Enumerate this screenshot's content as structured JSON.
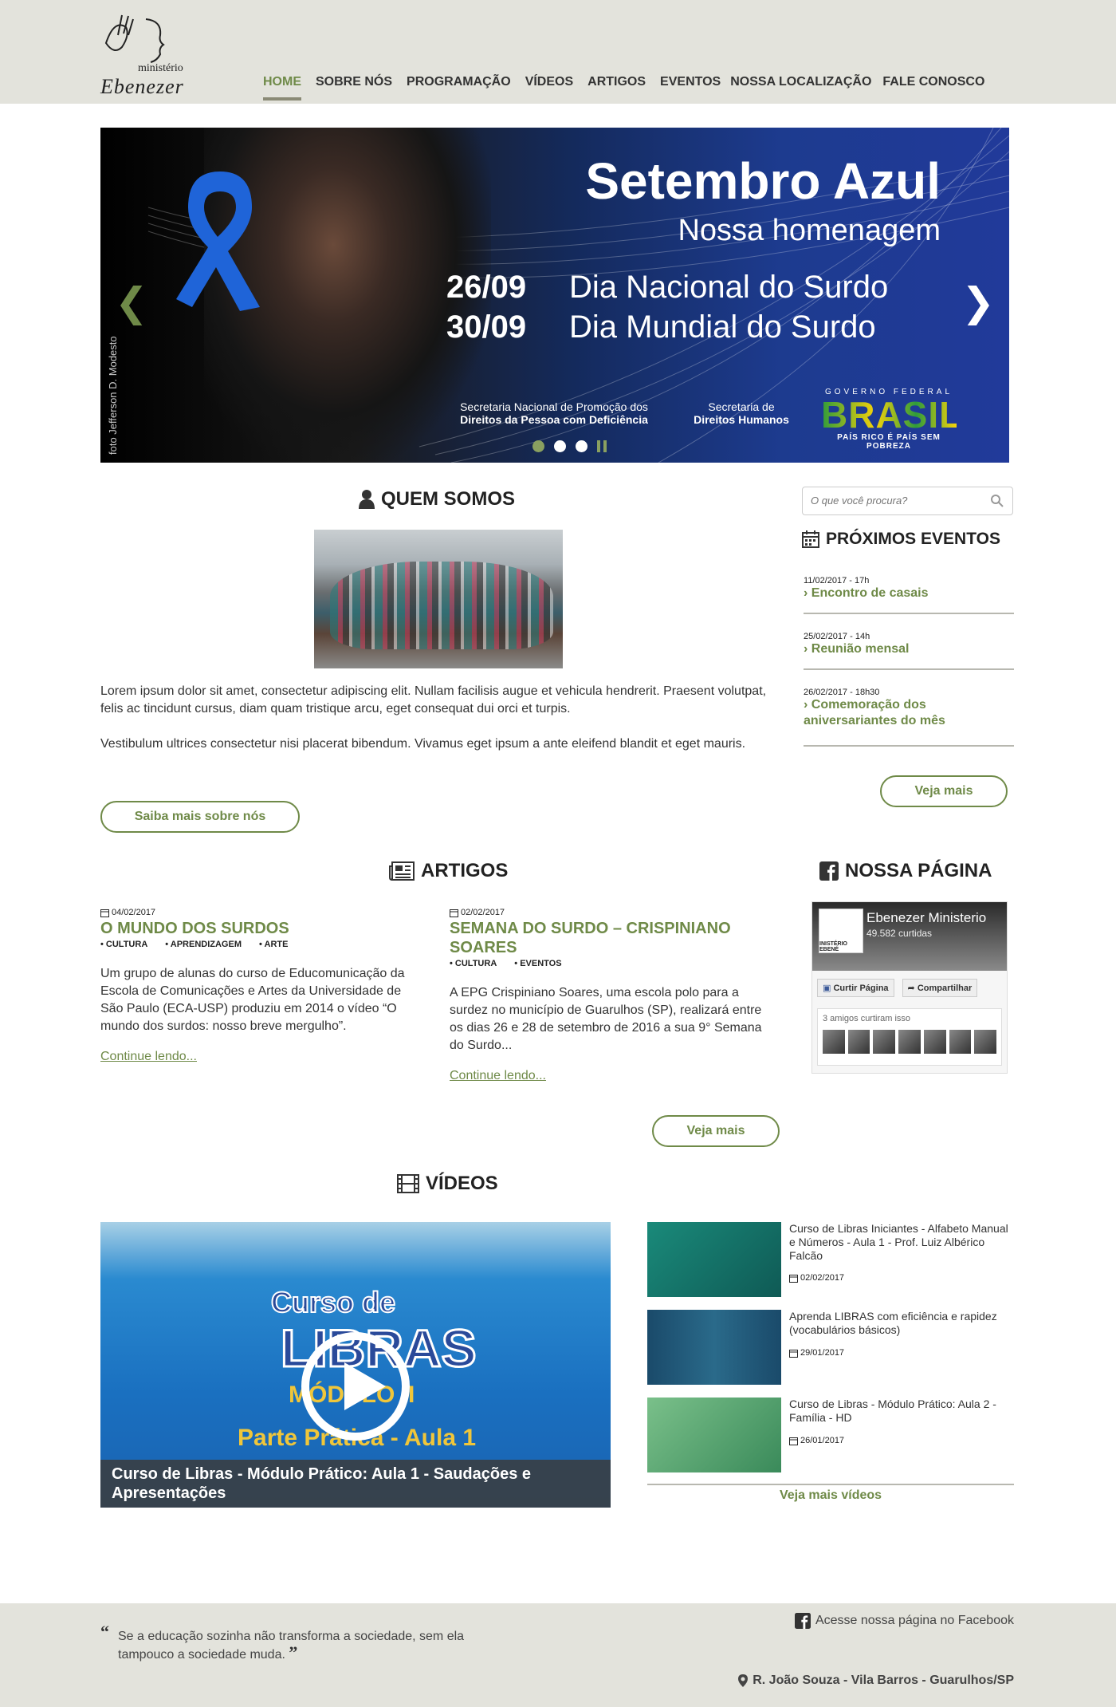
{
  "logo": {
    "line1": "ministério",
    "line2": "Ebenezer"
  },
  "nav": [
    "HOME",
    "SOBRE NÓS",
    "PROGRAMAÇÃO",
    "VÍDEOS",
    "ARTIGOS",
    "EVENTOS",
    "NOSSA LOCALIZAÇÃO",
    "FALE CONOSCO"
  ],
  "banner": {
    "photo_credit": "foto Jefferson D. Modesto",
    "title": "Setembro Azul",
    "subtitle": "Nossa homenagem",
    "dates": [
      {
        "date": "26/09",
        "label": "Dia Nacional do Surdo"
      },
      {
        "date": "30/09",
        "label": "Dia Mundial do Surdo"
      }
    ],
    "sec1_line1": "Secretaria Nacional de Promoção dos",
    "sec1_line2": "Direitos da Pessoa com Deficiência",
    "sec2_line1": "Secretaria de",
    "sec2_line2": "Direitos Humanos",
    "gov_top": "GOVERNO FEDERAL",
    "gov_main": "BRASIL",
    "gov_bottom": "PAÍS RICO É PAÍS SEM POBREZA"
  },
  "about": {
    "title": "QUEM SOMOS",
    "p1": "Lorem ipsum dolor sit amet, consectetur adipiscing elit. Nullam facilisis augue et vehicula hendrerit. Praesent volutpat, felis ac tincidunt cursus, diam quam tristique arcu, eget consequat dui orci et turpis.",
    "p2": "Vestibulum ultrices consectetur nisi placerat bibendum. Vivamus eget ipsum a ante eleifend blandit et eget mauris.",
    "button": "Saiba mais sobre nós"
  },
  "search": {
    "placeholder": "O que você procura?"
  },
  "events": {
    "title": "PRÓXIMOS EVENTOS",
    "items": [
      {
        "date": "11/02/2017 - 17h",
        "name": "Encontro de casais"
      },
      {
        "date": "25/02/2017 - 14h",
        "name": "Reunião mensal"
      },
      {
        "date": "26/02/2017 - 18h30",
        "name": "Comemoração dos aniversariantes do mês"
      }
    ],
    "button": "Veja mais"
  },
  "articles": {
    "title": "ARTIGOS",
    "items": [
      {
        "date": "04/02/2017",
        "title": "O MUNDO DOS SURDOS",
        "tags": [
          "CULTURA",
          "APRENDIZAGEM",
          "ARTE"
        ],
        "excerpt": "Um grupo de alunas do curso de Educomunicação da Escola de Comunicações e Artes da Universidade de São Paulo (ECA-USP) produziu em 2014 o vídeo “O mundo dos surdos: nosso breve mergulho”.",
        "more": "Continue lendo..."
      },
      {
        "date": "02/02/2017",
        "title": "SEMANA DO SURDO – CRISPINIANO SOARES",
        "tags": [
          "CULTURA",
          "EVENTOS"
        ],
        "excerpt": "A EPG Crispiniano Soares, uma escola polo para a surdez no município de Guarulhos (SP), realizará entre os dias 26 e 28 de setembro de 2016 a sua 9° Semana do Surdo...",
        "more": "Continue lendo..."
      }
    ],
    "button": "Veja mais"
  },
  "facebook": {
    "title": "NOSSA PÁGINA",
    "page_name": "Ebenezer Ministerio",
    "likes": "49.582 curtidas",
    "avatar_text": "INISTÉRIO EBENÉ",
    "like_button": "Curtir Página",
    "share_button": "Compartilhar",
    "friends": "3 amigos curtiram isso"
  },
  "videos": {
    "title": "VÍDEOS",
    "main": {
      "thumb_line1": "Curso de",
      "thumb_line2": "LIBRAS",
      "thumb_line3": "MÓDULO II",
      "thumb_line4": "Parte Prática - Aula 1",
      "caption": "Curso de Libras - Módulo Prático: Aula 1 - Saudações e Apresentações"
    },
    "list": [
      {
        "title": "Curso de Libras Iniciantes - Alfabeto Manual e Números - Aula 1 - Prof. Luiz Albérico Falcão",
        "date": "02/02/2017"
      },
      {
        "title": "Aprenda LIBRAS com eficiência e rapidez (vocabulários básicos)",
        "date": "29/01/2017"
      },
      {
        "title": "Curso de Libras - Módulo Prático: Aula 2 - Família - HD",
        "date": "26/01/2017"
      }
    ],
    "more": "Veja mais vídeos"
  },
  "footer": {
    "quote": "Se a educação sozinha não transforma a sociedade, sem ela tampouco a sociedade muda.",
    "facebook_link": "Acesse nossa página no Facebook",
    "address": "R. João Souza - Vila Barros - Guarulhos/SP"
  },
  "colors": {
    "accent": "#6f8a48",
    "header_bg": "#e3e3dc"
  }
}
